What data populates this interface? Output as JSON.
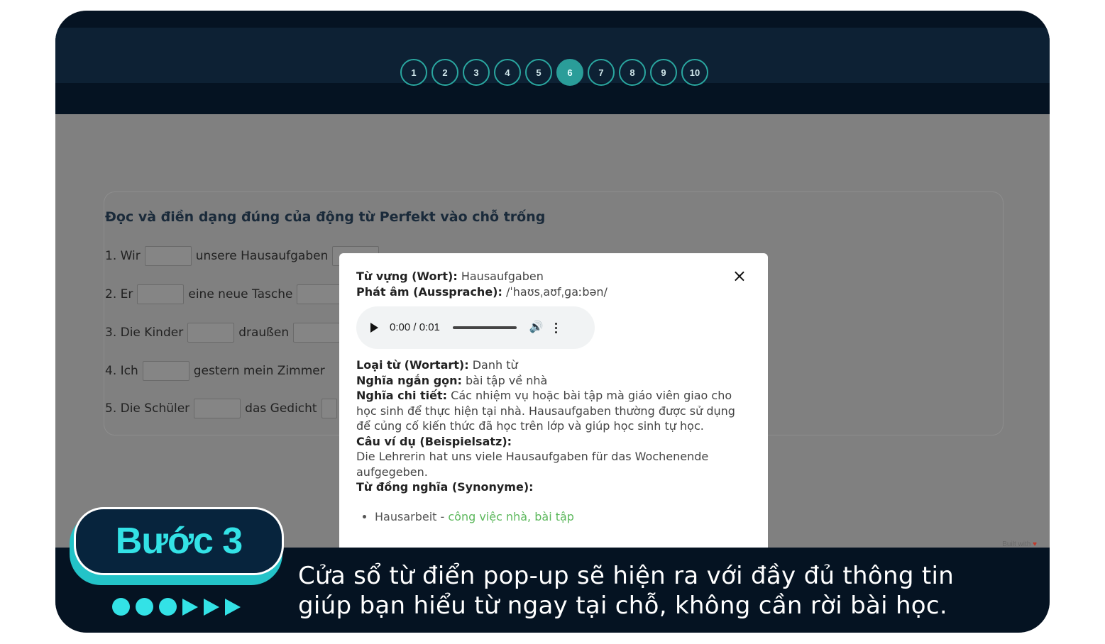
{
  "pager": {
    "pages": [
      "1",
      "2",
      "3",
      "4",
      "5",
      "6",
      "7",
      "8",
      "9",
      "10"
    ],
    "active": "6"
  },
  "quiz": {
    "title": "Đọc và điền dạng đúng của động từ Perfekt vào chỗ trống",
    "questions": [
      {
        "prefix": "1. Wir",
        "middle": "unsere Hausaufgaben"
      },
      {
        "prefix": "2. Er",
        "middle": "eine neue Tasche"
      },
      {
        "prefix": "3. Die Kinder",
        "middle": "draußen"
      },
      {
        "prefix": "4. Ich",
        "middle": "gestern mein Zimmer"
      },
      {
        "prefix": "5. Die Schüler",
        "middle": "das Gedicht"
      }
    ]
  },
  "built_with": "Built with",
  "dictionary_popup": {
    "close_icon": "×",
    "word_label": "Từ vựng (Wort):",
    "word_value": "Hausaufgaben",
    "pron_label": "Phát âm (Aussprache):",
    "pron_value": "/ˈhaʊsˌaʊfˌɡaːbən/",
    "audio": {
      "time": "0:00 / 0:01",
      "icons": [
        "play-icon",
        "volume-icon",
        "more-vert-icon"
      ]
    },
    "type_label": "Loại từ (Wortart):",
    "type_value": "Danh từ",
    "short_label": "Nghĩa ngắn gọn:",
    "short_value": "bài tập về nhà",
    "detail_label": "Nghĩa chi tiết:",
    "detail_value": "Các nhiệm vụ hoặc bài tập mà giáo viên giao cho học sinh để thực hiện tại nhà. Hausaufgaben thường được sử dụng để củng cố kiến thức đã học trên lớp và giúp học sinh tự học.",
    "example_label": "Câu ví dụ (Beispielsatz):",
    "example_value": "Die Lehrerin hat uns viele Hausaufgaben für das Wochenende aufgegeben.",
    "synonym_label": "Từ đồng nghĩa (Synonyme):",
    "synonyms": [
      {
        "word": "Hausarbeit - ",
        "meaning": "công việc nhà, bài tập"
      }
    ]
  },
  "step": {
    "badge": "Bước 3",
    "caption_line1": "Cửa sổ từ điển pop-up sẽ hiện ra với đầy đủ thông tin",
    "caption_line2": "giúp bạn hiểu từ ngay tại chỗ, không cần rời bài học."
  },
  "colors": {
    "accent": "#33e2e6",
    "navy": "#051322",
    "teal": "#2a9d99",
    "synonym_green": "#5cb85c"
  }
}
